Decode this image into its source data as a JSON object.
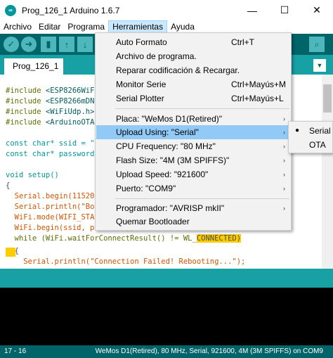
{
  "window": {
    "title": "Prog_126_1 Arduino 1.6.7",
    "min_glyph": "—",
    "max_glyph": "☐",
    "close_glyph": "✕",
    "icon_glyph": "∞"
  },
  "menubar": {
    "items": [
      {
        "label": "Archivo"
      },
      {
        "label": "Editar"
      },
      {
        "label": "Programa"
      },
      {
        "label": "Herramientas",
        "active": true
      },
      {
        "label": "Ayuda"
      }
    ]
  },
  "toolbar": {
    "verify_icon": "check-icon",
    "verify_glyph": "✓",
    "upload_icon": "arrow-right-icon",
    "upload_glyph": "➜",
    "new_glyph": "▮",
    "open_glyph": "↑",
    "save_glyph": "↓",
    "serial_monitor_glyph": "⌕"
  },
  "tabs": {
    "active": "Prog_126_1",
    "menu_glyph": "▼"
  },
  "editor": {
    "lines": [
      {
        "a": "#include ",
        "b": "<ESP8266WiF"
      },
      {
        "a": "#include ",
        "b": "<ESP8266mDN"
      },
      {
        "a": "#include ",
        "b": "<WiFiUdp.h>"
      },
      {
        "a": "#include ",
        "b": "<ArduinoOTA"
      },
      {
        "a": "const char* ssid = \""
      },
      {
        "a": "const char* password"
      },
      {
        "a": "void setup()"
      },
      {
        "a": "{"
      },
      {
        "a": "  Serial.begin(11520"
      },
      {
        "a": "  Serial.println(\"Bo"
      },
      {
        "a": "  WiFi.mode(WIFI_STA"
      },
      {
        "a": "  WiFi.begin(ssid, password);"
      },
      {
        "a": "  while (WiFi.waitForConnectResult() != WL_",
        "b": "CONNECTED)"
      },
      {
        "a": "  {"
      },
      {
        "a": "    Serial.println(\"Connection Failed! Rebooting...\");"
      }
    ]
  },
  "footer": {
    "line": "17 - 16",
    "board": "WeMos D1(Retired), 80 MHz, Serial, 921600, 4M (3M SPIFFS) on COM9"
  },
  "dropdown": {
    "items": [
      {
        "label": "Auto Formato",
        "shortcut": "Ctrl+T"
      },
      {
        "label": "Archivo de programa."
      },
      {
        "label": "Reparar codificación & Recargar."
      },
      {
        "label": "Monitor Serie",
        "shortcut": "Ctrl+Mayús+M"
      },
      {
        "label": "Serial Plotter",
        "shortcut": "Ctrl+Mayús+L"
      },
      {
        "label": "Placa: \"WeMos D1(Retired)\"",
        "submenu": true
      },
      {
        "label": "Upload Using: \"Serial\"",
        "submenu": true,
        "highlighted": true
      },
      {
        "label": "CPU Frequency: \"80 MHz\"",
        "submenu": true
      },
      {
        "label": "Flash Size: \"4M (3M SPIFFS)\"",
        "submenu": true
      },
      {
        "label": "Upload Speed: \"921600\"",
        "submenu": true
      },
      {
        "label": "Puerto: \"COM9\"",
        "submenu": true
      },
      {
        "label": "Programador: \"AVRISP mkII\"",
        "submenu": true
      },
      {
        "label": "Quemar Bootloader"
      }
    ],
    "arrow_glyph": "›"
  },
  "submenu": {
    "items": [
      {
        "label": "Serial",
        "selected": true
      },
      {
        "label": "OTA"
      }
    ],
    "bullet_glyph": "●"
  },
  "colors": {
    "toolbar": "#006468",
    "tabstrip": "#17a1a5",
    "highlight": "#91c9f7",
    "code_highlight": "#ffcc00"
  }
}
